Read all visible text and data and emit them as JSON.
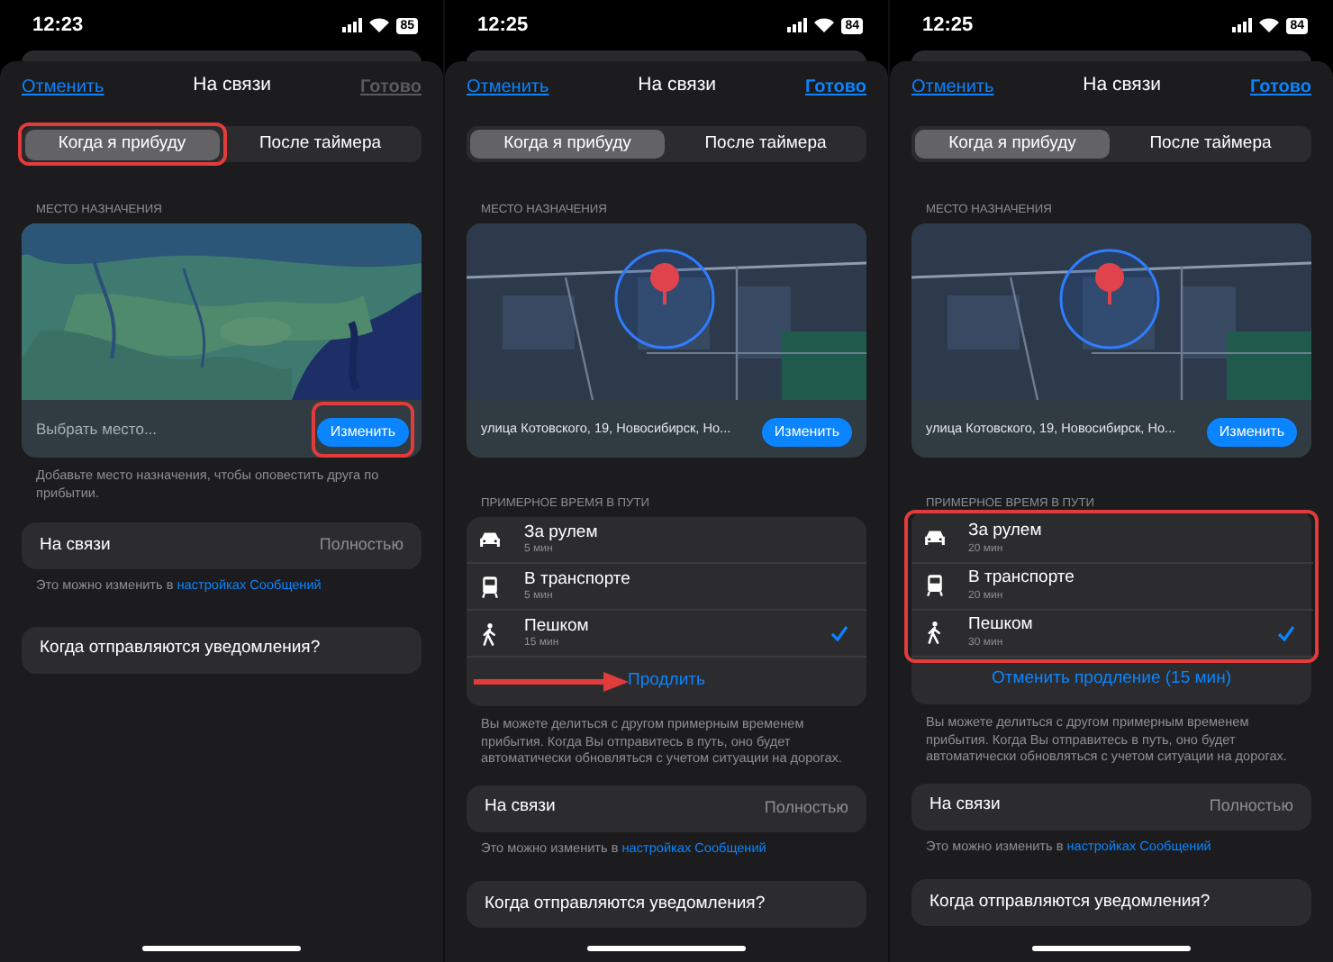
{
  "panels": [
    {
      "status_bar": {
        "time": "12:23",
        "battery": "85"
      },
      "nav": {
        "cancel": "Отменить",
        "title": "На связи",
        "done": "Готово",
        "done_enabled": false
      },
      "segments": [
        {
          "label": "Когда я прибуду",
          "selected": true,
          "highlighted": true
        },
        {
          "label": "После таймера",
          "selected": false,
          "highlighted": false
        }
      ],
      "destination": {
        "header": "МЕСТО НАЗНАЧЕНИЯ",
        "address": {
          "placeholder": "Выбрать место..."
        },
        "button": "Изменить",
        "button_highlighted": true,
        "note": "Добавьте место назначения, чтобы оповестить друга по прибытии."
      },
      "sharing": {
        "label": "На связи",
        "value": "Полностью",
        "note": "Это можно изменить в ",
        "note_link": "настройках Сообщений"
      },
      "notifications_link": "Когда отправляются уведомления?"
    },
    {
      "status_bar": {
        "time": "12:25",
        "battery": "84"
      },
      "nav": {
        "cancel": "Отменить",
        "title": "На связи",
        "done": "Готово",
        "done_enabled": true
      },
      "segments": [
        {
          "label": "Когда я прибуду",
          "selected": true,
          "highlighted": false
        },
        {
          "label": "После таймера",
          "selected": false,
          "highlighted": false
        }
      ],
      "destination": {
        "header": "МЕСТО НАЗНАЧЕНИЯ",
        "address": {
          "value": "улица Котовского, 19, Новосибирск, Но..."
        },
        "button": "Изменить"
      },
      "travel": {
        "header": "ПРИМЕРНОЕ ВРЕМЯ В ПУТИ",
        "modes": [
          {
            "kind": "car",
            "label": "За рулем",
            "time": "5 мин",
            "selected": false
          },
          {
            "kind": "transit",
            "label": "В транспорте",
            "time": "5 мин",
            "selected": false
          },
          {
            "kind": "walk",
            "label": "Пешком",
            "time": "15 мин",
            "selected": true
          }
        ],
        "action": "Продлить",
        "action_arrow": true,
        "note": "Вы можете делиться с другом примерным временем прибытия. Когда Вы отправитесь в путь, оно будет автоматически обновляться с учетом ситуации на дорогах."
      },
      "sharing": {
        "label": "На связи",
        "value": "Полностью",
        "note": "Это можно изменить в ",
        "note_link": "настройках Сообщений"
      },
      "notifications_link": "Когда отправляются уведомления?"
    },
    {
      "status_bar": {
        "time": "12:25",
        "battery": "84"
      },
      "nav": {
        "cancel": "Отменить",
        "title": "На связи",
        "done": "Готово",
        "done_enabled": true
      },
      "segments": [
        {
          "label": "Когда я прибуду",
          "selected": true,
          "highlighted": false
        },
        {
          "label": "После таймера",
          "selected": false,
          "highlighted": false
        }
      ],
      "destination": {
        "header": "МЕСТО НАЗНАЧЕНИЯ",
        "address": {
          "value": "улица Котовского, 19, Новосибирск, Но..."
        },
        "button": "Изменить"
      },
      "travel": {
        "header": "ПРИМЕРНОЕ ВРЕМЯ В ПУТИ",
        "highlighted": true,
        "modes": [
          {
            "kind": "car",
            "label": "За рулем",
            "time": "20 мин",
            "selected": false
          },
          {
            "kind": "transit",
            "label": "В транспорте",
            "time": "20 мин",
            "selected": false
          },
          {
            "kind": "walk",
            "label": "Пешком",
            "time": "30 мин",
            "selected": true
          }
        ],
        "action": "Отменить продление (15 мин)",
        "note": "Вы можете делиться с другом примерным временем прибытия. Когда Вы отправитесь в путь, оно будет автоматически обновляться с учетом ситуации на дорогах."
      },
      "sharing": {
        "label": "На связи",
        "value": "Полностью",
        "note": "Это можно изменить в ",
        "note_link": "настройках Сообщений"
      },
      "notifications_link": "Когда отправляются уведомления?"
    }
  ]
}
